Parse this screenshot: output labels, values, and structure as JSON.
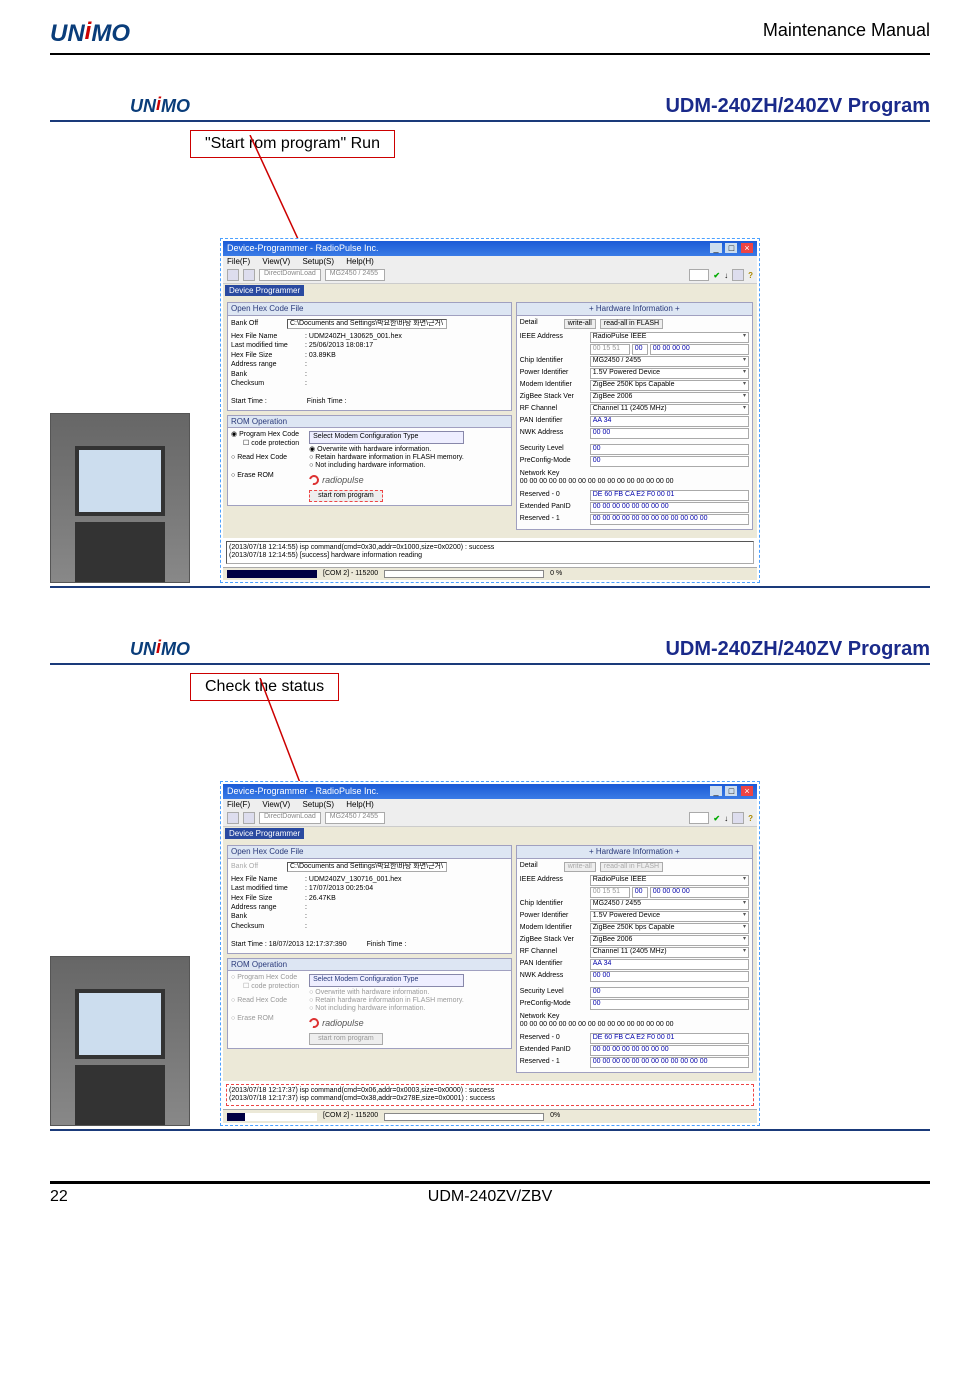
{
  "header": {
    "logo_text": "UNIMO",
    "manual": "Maintenance Manual"
  },
  "footer": {
    "page": "22",
    "model": "UDM-240ZV/ZBV"
  },
  "section1": {
    "logo": "UNIMO",
    "title": "UDM-240ZH/240ZV Program",
    "callout": "\"Start rom program\"  Run",
    "window": {
      "title": "Device-Programmer - RadioPulse Inc.",
      "menu": [
        "File(F)",
        "View(V)",
        "Setup(S)",
        "Help(H)"
      ],
      "toolbar_dd1": "DirectDownLoad",
      "toolbar_dd2": "MG2450 / 2455",
      "device_programmer_tab": "Device Programmer",
      "open_hex_title": "Open Hex Code File",
      "bank_label": "Bank Off",
      "file_path": "C:\\Documents and Settings\\박요한\\바탕 화면\\근거\\",
      "file_info": {
        "name_k": "Hex File Name",
        "name_v": ": UDM240ZH_130625_001.hex",
        "lmt_k": "Last modified time",
        "lmt_v": ": 25/06/2013  18:08:17",
        "size_k": "Hex File Size",
        "size_v": ": 03.89KB",
        "addr_k": "Address range",
        "addr_v": ":",
        "bank_k": "Bank",
        "bank_v": ":",
        "chk_k": "Checksum",
        "chk_v": ":"
      },
      "start_time_k": "Start Time  :",
      "finish_time_k": "Finish Time  :",
      "rom_title": "ROM Operation",
      "rom_opts": {
        "program": "Program Hex Code",
        "codeprot": "code protection",
        "read": "Read Hex Code",
        "erase": "Erase ROM"
      },
      "mct_title": "Select Modem Configuration Type",
      "mct_opts": {
        "overwrite": "Overwrite with hardware information.",
        "retain": "Retain hardware information in FLASH memory.",
        "notinc": "Not including hardware information."
      },
      "rp_logo": "radiopulse",
      "rom_btn": "start rom program",
      "hw_title": "+ Hardware Information +",
      "hw_top_detail": "Detail",
      "hw_top_write": "write-all",
      "hw_top_read": "read-all in FLASH",
      "ieee_lbl": "IEEE Address",
      "ieee_val": "RadioPulse IEEE",
      "ieee_hex1": "00 15 51",
      "ieee_hex2": "00",
      "ieee_hex3": "00 00 00 00",
      "rows": [
        {
          "lbl": "Chip Identifier",
          "val": "MG2450 / 2455"
        },
        {
          "lbl": "Power Identifier",
          "val": "1.5V Powered Device"
        },
        {
          "lbl": "Modem Identifier",
          "val": "ZigBee 250K bps Capable"
        },
        {
          "lbl": "ZigBee Stack Ver",
          "val": "ZigBee 2006"
        },
        {
          "lbl": "RF Channel",
          "val": "Channel 11 (2405 MHz)"
        },
        {
          "lbl": "PAN Identifier",
          "val": "AA 34",
          "blue": true
        },
        {
          "lbl": "NWK Address",
          "val": "00 00",
          "blue": true
        }
      ],
      "sec_lbl": "Security Level",
      "sec_val": "00",
      "pre_lbl": "PreConfig-Mode",
      "pre_val": "00",
      "netkey_lbl": "Network Key",
      "netkey_val": "00 00 00 00 00 00 00 00 00 00 00 00 00 00 00 00",
      "res0_lbl": "Reserved - 0",
      "res0_val": "DE 60 FB CA E2 F0 00 01",
      "ext_lbl": "Extended PanID",
      "ext_val": "00 00 00 00 00 00 00 00",
      "res1_lbl": "Reserved - 1",
      "res1_val": "00 00 00 00 00 00 00 00 00 00 00 00",
      "log": [
        "(2013/07/18 12:14:55) isp command(cmd=0x30,addr=0x1000,size=0x0200) : success",
        "(2013/07/18 12:14:55) [success] hardware information reading"
      ],
      "status_port": "[COM 2] - 115200",
      "status_pct": "0 %"
    }
  },
  "section2": {
    "logo": "UNIMO",
    "title": "UDM-240ZH/240ZV Program",
    "callout": "Check the status",
    "window": {
      "title": "Device-Programmer - RadioPulse Inc.",
      "menu": [
        "File(F)",
        "View(V)",
        "Setup(S)",
        "Help(H)"
      ],
      "toolbar_dd1": "DirectDownLoad",
      "toolbar_dd2": "MG2450 / 2455",
      "device_programmer_tab": "Device Programmer",
      "open_hex_title": "Open Hex Code File",
      "bank_label": "Bank Off",
      "file_path": "C:\\Documents and Settings\\박요한\\바탕 화면\\근거\\",
      "file_info": {
        "name_k": "Hex File Name",
        "name_v": ": UDM240ZV_130716_001.hex",
        "lmt_k": "Last modified time",
        "lmt_v": ": 17/07/2013  00:25:04",
        "size_k": "Hex File Size",
        "size_v": ": 26.47KB",
        "addr_k": "Address range",
        "addr_v": ":",
        "bank_k": "Bank",
        "bank_v": ":",
        "chk_k": "Checksum",
        "chk_v": ":"
      },
      "start_time_k": "Start Time   : 18/07/2013  12:17:37:390",
      "finish_time_k": "Finish Time  :",
      "rom_title": "ROM Operation",
      "rom_opts": {
        "program": "Program Hex Code",
        "codeprot": "code protection",
        "read": "Read Hex Code",
        "erase": "Erase ROM"
      },
      "mct_title": "Select Modem Configuration Type",
      "mct_opts": {
        "overwrite": "Overwrite with hardware information.",
        "retain": "Retain hardware information in FLASH memory.",
        "notinc": "Not including hardware information."
      },
      "rp_logo": "radiopulse",
      "rom_btn": "start rom program",
      "hw_title": "+ Hardware Information +",
      "hw_top_detail": "Detail",
      "hw_top_write": "write-all",
      "hw_top_read": "read-all in FLASH",
      "ieee_lbl": "IEEE Address",
      "ieee_val": "RadioPulse IEEE",
      "ieee_hex1": "00 15 51",
      "ieee_hex2": "00",
      "ieee_hex3": "00 00 00 00",
      "rows": [
        {
          "lbl": "Chip Identifier",
          "val": "MG2450 / 2455"
        },
        {
          "lbl": "Power Identifier",
          "val": "1.5V Powered Device"
        },
        {
          "lbl": "Modem Identifier",
          "val": "ZigBee 250K bps Capable"
        },
        {
          "lbl": "ZigBee Stack Ver",
          "val": "ZigBee 2006"
        },
        {
          "lbl": "RF Channel",
          "val": "Channel 11 (2405 MHz)"
        },
        {
          "lbl": "PAN Identifier",
          "val": "AA 34",
          "blue": true
        },
        {
          "lbl": "NWK Address",
          "val": "00 00",
          "blue": true
        }
      ],
      "sec_lbl": "Security Level",
      "sec_val": "00",
      "pre_lbl": "PreConfig-Mode",
      "pre_val": "00",
      "netkey_lbl": "Network Key",
      "netkey_val": "00 00 00 00 00 00 00 00 00 00 00 00 00 00 00 00",
      "res0_lbl": "Reserved - 0",
      "res0_val": "DE 60 FB CA E2 F0 00 01",
      "ext_lbl": "Extended PanID",
      "ext_val": "00 00 00 00 00 00 00 00",
      "res1_lbl": "Reserved - 1",
      "res1_val": "00 00 00 00 00 00 00 00 00 00 00 00",
      "log": [
        "(2013/07/18 12:17:37) isp command(cmd=0x06,addr=0x0003,size=0x0000) : success",
        "(2013/07/18 12:17:37) isp command(cmd=0x38,addr=0x278E,size=0x0001) : success"
      ],
      "status_port": "[COM 2] - 115200",
      "status_pct": "0%"
    }
  }
}
